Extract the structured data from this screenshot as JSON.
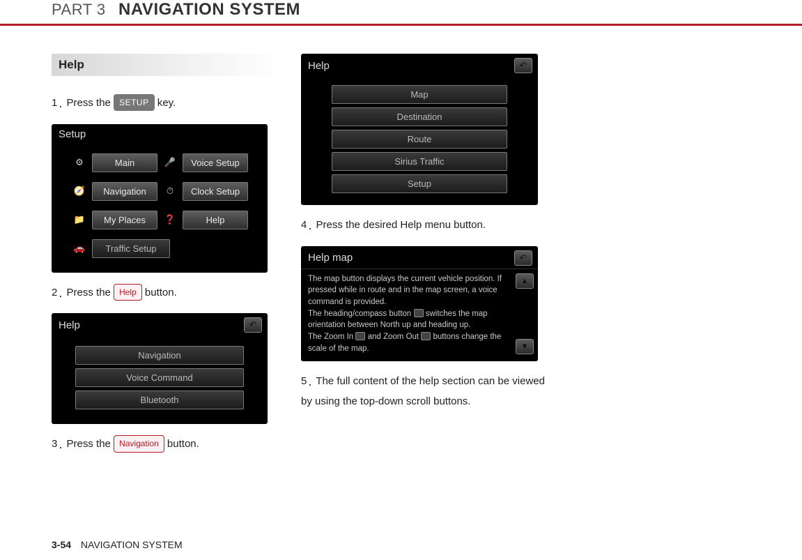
{
  "header": {
    "part": "PART 3",
    "title": "NAVIGATION SYSTEM"
  },
  "section_heading": "Help",
  "steps": {
    "s1": {
      "num": "1",
      "before": "Press the ",
      "cap": "SETUP",
      "after": " key."
    },
    "s2": {
      "num": "2",
      "before": "Press the ",
      "cap": "Help",
      "after": " button."
    },
    "s3": {
      "num": "3",
      "before": "Press the ",
      "cap": "Navigation",
      "after": " button."
    },
    "s4": {
      "num": "4",
      "text": "Press the desired Help menu button."
    },
    "s5": {
      "num": "5",
      "text": "The full content of the help section can be viewed by using the top-down scroll buttons."
    }
  },
  "device_setup": {
    "title": "Setup",
    "rows": [
      {
        "icon": "⚙",
        "label": "Main",
        "icon2": "🎤",
        "label2": "Voice Setup"
      },
      {
        "icon": "🧭",
        "label": "Navigation",
        "icon2": "⏱",
        "label2": "Clock Setup"
      },
      {
        "icon": "📁",
        "label": "My Places",
        "icon2": "❓",
        "label2": "Help"
      }
    ],
    "last": {
      "icon": "🚗",
      "label": "Traffic Setup"
    }
  },
  "device_help1": {
    "title": "Help",
    "items": [
      "Navigation",
      "Voice Command",
      "Bluetooth"
    ]
  },
  "device_help2": {
    "title": "Help",
    "items": [
      "Map",
      "Destination",
      "Route",
      "Sirius Traffic",
      "Setup"
    ]
  },
  "device_helpmap": {
    "title": "Help map",
    "lines": [
      "The map button displays the current vehicle position. If pressed while in route and in the map screen, a voice command is provided.",
      "The heading/compass button ",
      " switches the map orientation between North up and heading up.",
      "The Zoom In ",
      " and Zoom Out ",
      " buttons change the scale of the map."
    ]
  },
  "footer": {
    "page": "3-54",
    "label": "NAVIGATION SYSTEM"
  },
  "icons": {
    "back": "↶",
    "up": "▲",
    "down": "▼"
  }
}
